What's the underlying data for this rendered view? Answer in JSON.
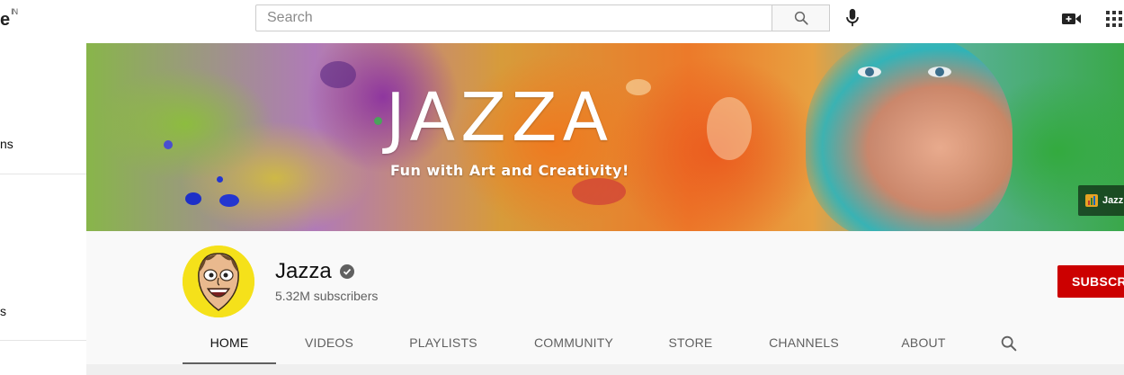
{
  "topbar": {
    "logo_text": "e",
    "logo_region": "IN",
    "search_placeholder": "Search",
    "search_icon": "search-icon",
    "mic_icon": "microphone-icon",
    "create_icon": "video-camera-icon",
    "apps_icon": "apps-grid-icon"
  },
  "sidebar": {
    "items": [
      {
        "label": "ns"
      },
      {
        "label": "s"
      }
    ]
  },
  "banner": {
    "title": "JAZZA",
    "tagline": "Fun with Art and Creativity!",
    "link_label": "Jazz"
  },
  "channel": {
    "name": "Jazza",
    "subscribers": "5.32M subscribers",
    "subscribe_label": "SUBSCRIBE",
    "verified_icon": "verified-check-icon",
    "accent_color": "#cc0000"
  },
  "tabs": [
    {
      "label": "HOME",
      "active": true
    },
    {
      "label": "VIDEOS"
    },
    {
      "label": "PLAYLISTS"
    },
    {
      "label": "COMMUNITY"
    },
    {
      "label": "STORE"
    },
    {
      "label": "CHANNELS"
    },
    {
      "label": "ABOUT"
    }
  ]
}
